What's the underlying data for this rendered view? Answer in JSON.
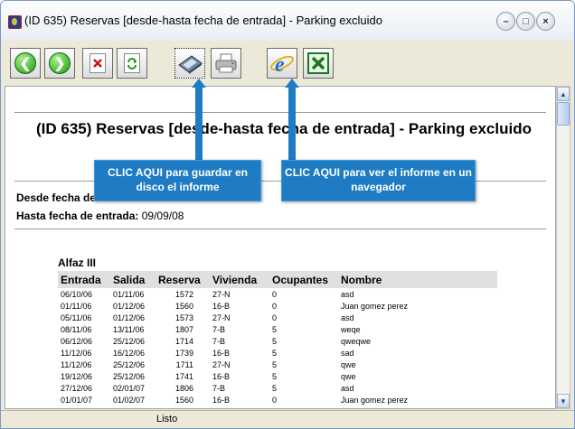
{
  "window": {
    "title": "(ID 635) Reservas [desde-hasta fecha de entrada] - Parking excluido"
  },
  "title_buttons": {
    "minimize": "–",
    "maximize": "□",
    "close": "×"
  },
  "toolbar": [
    {
      "name": "back-button",
      "icon": "arrow-left-icon"
    },
    {
      "name": "forward-button",
      "icon": "arrow-right-icon"
    },
    {
      "name": "stop-button",
      "icon": "close-document-icon"
    },
    {
      "name": "refresh-button",
      "icon": "refresh-icon"
    },
    {
      "name": "save-to-disk-button",
      "icon": "disk-icon"
    },
    {
      "name": "print-button",
      "icon": "printer-icon"
    },
    {
      "name": "open-in-browser-button",
      "icon": "internet-explorer-icon"
    },
    {
      "name": "export-excel-button",
      "icon": "excel-icon"
    }
  ],
  "report": {
    "title": "(ID 635) Reservas [desde-hasta fecha de entrada] - Parking excluido",
    "from_label": "Desde fecha de entrada:",
    "to_label": "Hasta fecha de entrada:",
    "to_value": "09/09/08",
    "section": "Alfaz III",
    "columns": [
      "Entrada",
      "Salida",
      "Reserva",
      "Vivienda",
      "Ocupantes",
      "Nombre"
    ],
    "rows": [
      [
        "06/10/06",
        "01/11/06",
        "1572",
        "27-N",
        "0",
        "asd"
      ],
      [
        "01/11/06",
        "01/12/06",
        "1560",
        "16-B",
        "0",
        "Juan gomez perez"
      ],
      [
        "05/11/06",
        "01/12/06",
        "1573",
        "27-N",
        "0",
        "asd"
      ],
      [
        "08/11/06",
        "13/11/06",
        "1807",
        "7-B",
        "5",
        "weqe"
      ],
      [
        "06/12/06",
        "25/12/06",
        "1714",
        "7-B",
        "5",
        "qweqwe"
      ],
      [
        "11/12/06",
        "16/12/06",
        "1739",
        "16-B",
        "5",
        "sad"
      ],
      [
        "11/12/06",
        "25/12/06",
        "1711",
        "27-N",
        "5",
        "qwe"
      ],
      [
        "19/12/06",
        "25/12/06",
        "1741",
        "16-B",
        "5",
        "qwe"
      ],
      [
        "27/12/06",
        "02/01/07",
        "1806",
        "7-B",
        "5",
        "asd"
      ],
      [
        "01/01/07",
        "01/02/07",
        "1560",
        "16-B",
        "0",
        "Juan gomez perez"
      ]
    ]
  },
  "callouts": {
    "save": "CLIC AQUI  para guardar en disco el informe",
    "browser": "CLIC AQUI  para ver el informe en un navegador"
  },
  "status": {
    "text": "Listo"
  },
  "colors": {
    "callout": "#1e7bc4",
    "header_bg": "#e0e0e0"
  }
}
